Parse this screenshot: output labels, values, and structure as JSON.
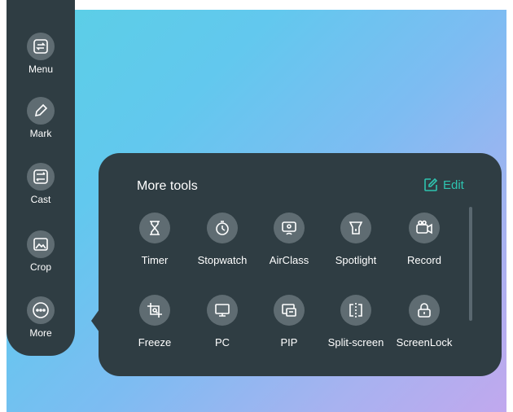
{
  "sidebar": {
    "items": [
      {
        "label": "Menu",
        "icon": "menu-icon"
      },
      {
        "label": "Mark",
        "icon": "pen-icon"
      },
      {
        "label": "Cast",
        "icon": "cast-icon"
      },
      {
        "label": "Crop",
        "icon": "crop-icon"
      },
      {
        "label": "More",
        "icon": "more-icon"
      }
    ]
  },
  "panel": {
    "title": "More tools",
    "edit_label": "Edit",
    "accent_color": "#2ec4b0",
    "tools": [
      {
        "label": "Timer",
        "icon": "hourglass-icon"
      },
      {
        "label": "Stopwatch",
        "icon": "stopwatch-icon"
      },
      {
        "label": "AirClass",
        "icon": "airclass-icon"
      },
      {
        "label": "Spotlight",
        "icon": "spotlight-icon"
      },
      {
        "label": "Record",
        "icon": "video-camera-icon"
      },
      {
        "label": "Freeze",
        "icon": "freeze-icon"
      },
      {
        "label": "PC",
        "icon": "monitor-icon"
      },
      {
        "label": "PIP",
        "icon": "pip-icon"
      },
      {
        "label": "Split-screen",
        "icon": "split-screen-icon"
      },
      {
        "label": "ScreenLock",
        "icon": "lock-icon"
      }
    ]
  }
}
